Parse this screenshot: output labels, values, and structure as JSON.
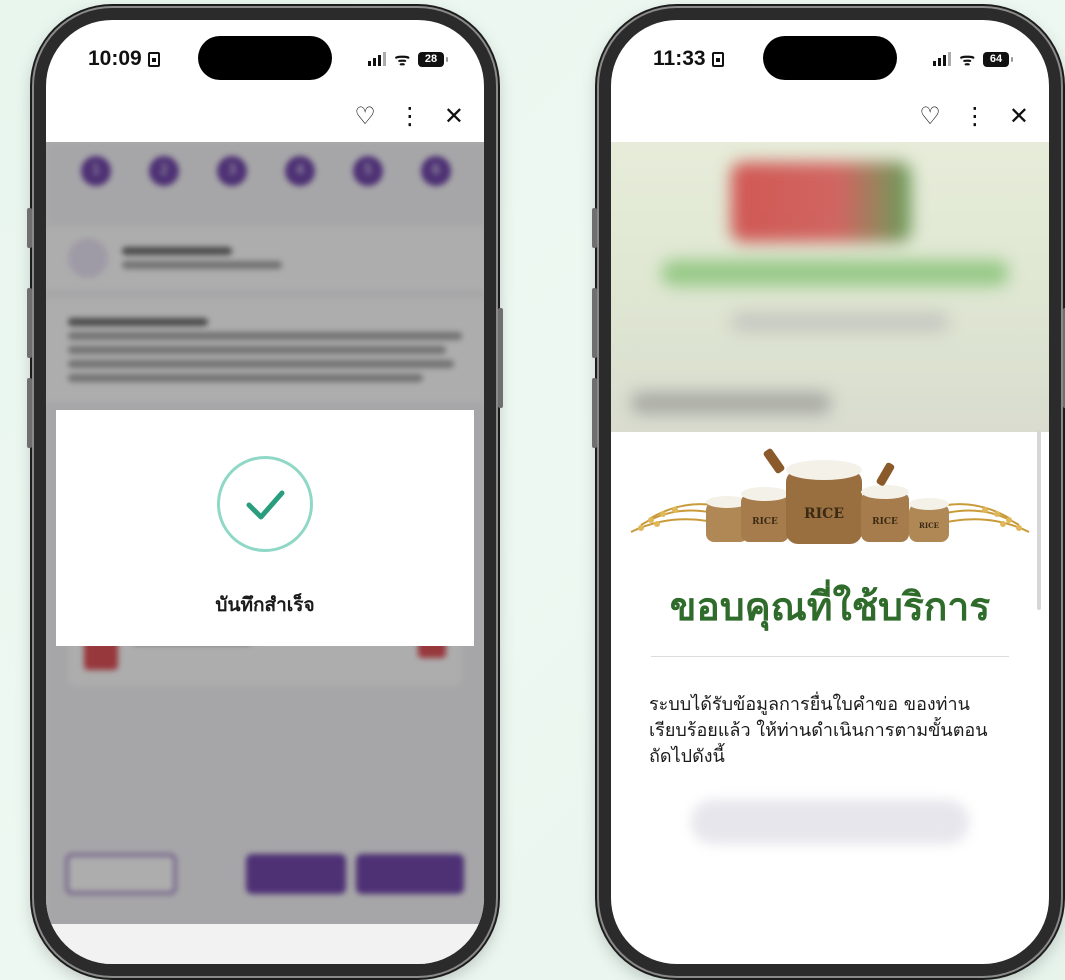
{
  "left_phone": {
    "status": {
      "time": "10:09",
      "battery": "28"
    },
    "toolbar": {
      "heart": "♡",
      "more": "⋮",
      "close": "✕"
    },
    "steps": [
      {
        "num": "1"
      },
      {
        "num": "2"
      },
      {
        "num": "3"
      },
      {
        "num": "4"
      },
      {
        "num": "5"
      },
      {
        "num": "6"
      }
    ],
    "modal": {
      "message": "บันทึกสำเร็จ"
    }
  },
  "right_phone": {
    "status": {
      "time": "11:33",
      "battery": "64"
    },
    "toolbar": {
      "heart": "♡",
      "more": "⋮",
      "close": "✕"
    },
    "rice_labels": [
      "RICE",
      "RICE",
      "RICE",
      "RICE"
    ],
    "heading": "ขอบคุณที่ใช้บริการ",
    "body_lines": [
      "ระบบได้รับข้อมูลการยื่นใบคำขอ ของท่าน",
      "เรียบร้อยแล้ว ให้ท่านดำเนินการตามขั้นตอน",
      "ถัดไปดังนี้"
    ]
  },
  "colors": {
    "accent_purple": "#5b2a9e",
    "check_teal": "#2a9d7f",
    "heading_green": "#2f6b2a",
    "background_mint": "#e8f6ee"
  }
}
